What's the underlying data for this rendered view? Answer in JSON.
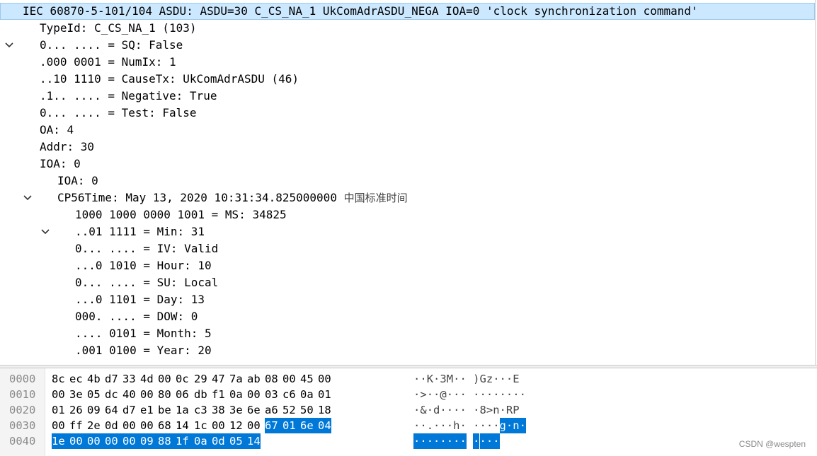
{
  "tree": {
    "title": "IEC 60870-5-101/104 ASDU: ASDU=30 C_CS_NA_1 UkComAdrASDU_NEGA IOA=0 'clock synchronization command'",
    "fields": [
      "TypeId: C_CS_NA_1 (103)",
      "0... .... = SQ: False",
      ".000 0001 = NumIx: 1",
      "..10 1110 = CauseTx: UkComAdrASDU (46)",
      ".1.. .... = Negative: True",
      "0... .... = Test: False",
      "OA: 4",
      "Addr: 30"
    ],
    "ioa_label": "IOA: 0",
    "ioa_child": "IOA: 0",
    "cp56_label": "CP56Time: May 13, 2020 10:31:34.825000000",
    "cp56_tz": "中国标准时间",
    "cp56_fields": [
      "1000 1000 0000 1001 = MS: 34825",
      "..01 1111 = Min: 31",
      "0... .... = IV: Valid",
      "...0 1010 = Hour: 10",
      "0... .... = SU: Local",
      "...0 1101 = Day: 13",
      "000. .... = DOW: 0",
      ".... 0101 = Month: 5",
      ".001 0100 = Year: 20"
    ]
  },
  "hex": {
    "offsets": [
      "0000",
      "0010",
      "0020",
      "0030",
      "0040"
    ],
    "bytes": [
      [
        "8c",
        "ec",
        "4b",
        "d7",
        "33",
        "4d",
        "00",
        "0c",
        "29",
        "47",
        "7a",
        "ab",
        "08",
        "00",
        "45",
        "00"
      ],
      [
        "00",
        "3e",
        "05",
        "dc",
        "40",
        "00",
        "80",
        "06",
        "db",
        "f1",
        "0a",
        "00",
        "03",
        "c6",
        "0a",
        "01"
      ],
      [
        "01",
        "26",
        "09",
        "64",
        "d7",
        "e1",
        "be",
        "1a",
        "c3",
        "38",
        "3e",
        "6e",
        "a6",
        "52",
        "50",
        "18"
      ],
      [
        "00",
        "ff",
        "2e",
        "0d",
        "00",
        "00",
        "68",
        "14",
        "1c",
        "00",
        "12",
        "00",
        "67",
        "01",
        "6e",
        "04"
      ],
      [
        "1e",
        "00",
        "00",
        "00",
        "00",
        "09",
        "88",
        "1f",
        "0a",
        "0d",
        "05",
        "14"
      ]
    ],
    "ascii": [
      [
        "·",
        "·",
        "K",
        "·",
        "3",
        "M",
        "·",
        "·",
        " ",
        ")",
        "G",
        "z",
        "·",
        "·",
        "·",
        "E"
      ],
      [
        "·",
        ">",
        "·",
        "·",
        "@",
        "·",
        "·",
        "·",
        " ",
        "·",
        "·",
        "·",
        "·",
        "·",
        "·",
        "·",
        "·"
      ],
      [
        "·",
        "&",
        "·",
        "d",
        "·",
        "·",
        "·",
        "·",
        " ",
        "·",
        "8",
        ">",
        "n",
        "·",
        "R",
        "P"
      ],
      [
        "·",
        "·",
        ".",
        "·",
        "·",
        "·",
        "h",
        "·",
        " ",
        "·",
        "·",
        "·",
        "·",
        "g",
        "·",
        "n",
        "·"
      ],
      [
        "·",
        "·",
        "·",
        "·",
        "·",
        "·",
        "·",
        "·",
        " ",
        "·",
        "·",
        "·",
        "·"
      ]
    ],
    "selection_start_index": 60,
    "selection_end_index": 75,
    "highlight_color": "#0078d7"
  },
  "watermark": "CSDN @wespten"
}
